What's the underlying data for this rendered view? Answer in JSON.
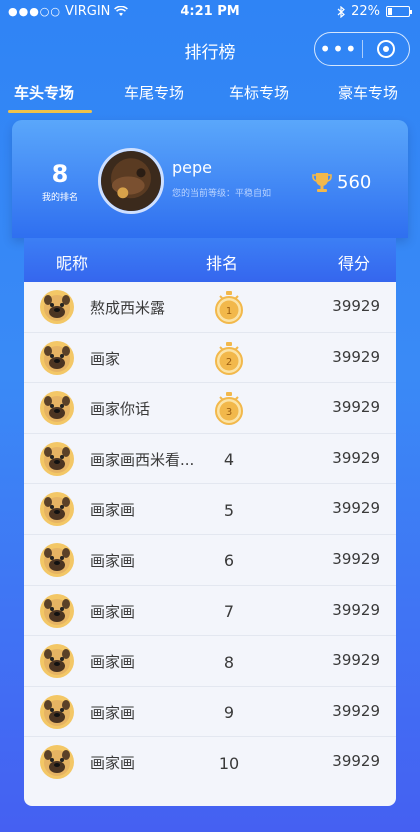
{
  "status_bar": {
    "carrier": "VIRGIN",
    "time": "4:21 PM",
    "battery": "22%"
  },
  "nav": {
    "title": "排行榜",
    "more_label": "•••"
  },
  "tabs": [
    {
      "label": "车头专场",
      "active": true
    },
    {
      "label": "车尾专场",
      "active": false
    },
    {
      "label": "车标专场",
      "active": false
    },
    {
      "label": "豪车专场",
      "active": false
    }
  ],
  "profile": {
    "rank": "8",
    "rank_label": "我的排名",
    "name": "pepe",
    "level_text": "您的当前等级：平稳自如",
    "score": "560"
  },
  "table": {
    "headers": {
      "nickname": "昵称",
      "rank": "排名",
      "score": "得分"
    },
    "rows": [
      {
        "name": "熬成西米露",
        "rank": "1",
        "score": "39929"
      },
      {
        "name": "画家",
        "rank": "2",
        "score": "39929"
      },
      {
        "name": "画家你话",
        "rank": "3",
        "score": "39929"
      },
      {
        "name": "画家画西米看...",
        "rank": "4",
        "score": "39929"
      },
      {
        "name": "画家画",
        "rank": "5",
        "score": "39929"
      },
      {
        "name": "画家画",
        "rank": "6",
        "score": "39929"
      },
      {
        "name": "画家画",
        "rank": "7",
        "score": "39929"
      },
      {
        "name": "画家画",
        "rank": "8",
        "score": "39929"
      },
      {
        "name": "画家画",
        "rank": "9",
        "score": "39929"
      },
      {
        "name": "画家画",
        "rank": "10",
        "score": "39929"
      }
    ]
  },
  "colors": {
    "accent_underline": "#f0c24a",
    "medal_gold": "#f2b84b"
  }
}
